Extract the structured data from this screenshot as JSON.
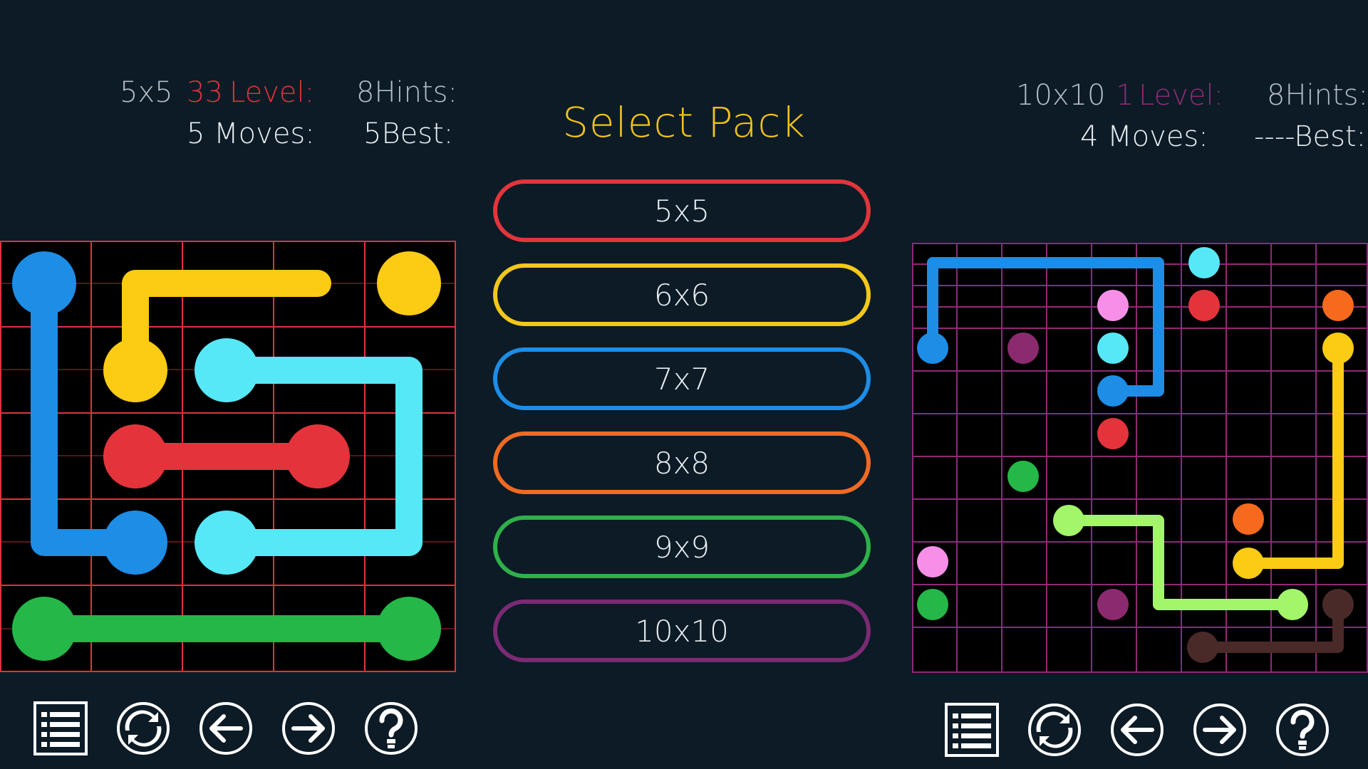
{
  "left_panel": {
    "hud": {
      "pack": "5x5",
      "level_number": "33",
      "level_label": "Level:",
      "hints": "8Hints:",
      "moves": "5 Moves:",
      "best": "5Best:"
    },
    "board": {
      "size": 5,
      "grid_color": "#e0323c"
    },
    "toolbar": [
      "menu-icon",
      "restart-icon",
      "previous-icon",
      "next-icon",
      "hint-icon"
    ]
  },
  "center": {
    "title": "Select Pack",
    "title_color": "#f1c318",
    "packs": [
      {
        "label": "5x5",
        "color": "#e1353c"
      },
      {
        "label": "6x6",
        "color": "#f2c81a"
      },
      {
        "label": "7x7",
        "color": "#1d8de6"
      },
      {
        "label": "8x8",
        "color": "#ef6a23"
      },
      {
        "label": "9x9",
        "color": "#2fb04a"
      },
      {
        "label": "10x10",
        "color": "#7b2a74"
      }
    ]
  },
  "right_panel": {
    "hud": {
      "pack": "10x10",
      "level_number": "1",
      "level_label": "Level:",
      "hints": "8Hints:",
      "moves": "4 Moves:",
      "best": "----Best:"
    },
    "board": {
      "size": 10,
      "grid_color": "#8e2a78"
    },
    "toolbar": [
      "menu-icon",
      "restart-icon",
      "previous-icon",
      "next-icon",
      "hint-icon"
    ]
  },
  "colors": {
    "background": "#0c1b26",
    "level_left": "#e0323c",
    "level_right": "#8e2a78",
    "blue": "#1d8de6",
    "yellow": "#fccb14",
    "cyan": "#56e8f7",
    "red": "#e5333c",
    "green": "#25b748",
    "pink": "#f78fe9",
    "purple": "#8b2a6e",
    "orange": "#f76a1e",
    "lime": "#a3f56a",
    "brown": "#4a2a28"
  }
}
